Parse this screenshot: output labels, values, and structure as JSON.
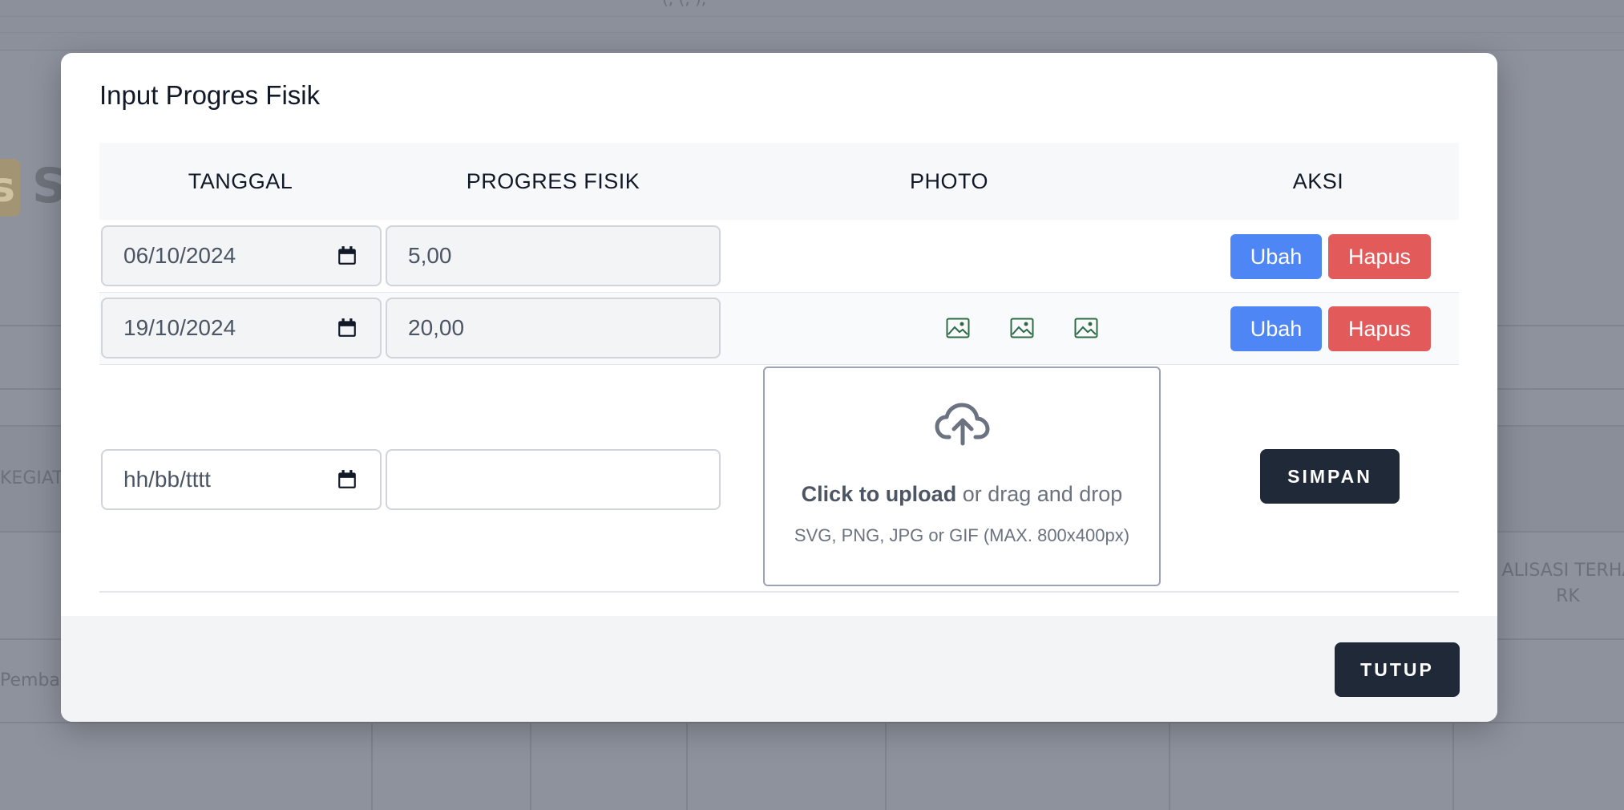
{
  "background": {
    "top_text": "(, (, ),",
    "logo_letter": "s",
    "title_initial": "S",
    "col_partial_left": "KEGIATA",
    "col_partial_right_line1": "ALISASI TERHA",
    "col_partial_right_line2": "RK",
    "row_partial_left": "Pemba"
  },
  "modal": {
    "title": "Input Progres Fisik",
    "table": {
      "headers": [
        "TANGGAL",
        "PROGRES FISIK",
        "PHOTO",
        "AKSI"
      ],
      "rows": [
        {
          "date": "06/10/2024",
          "progress": "5,00",
          "photos": []
        },
        {
          "date": "19/10/2024",
          "progress": "20,00",
          "photos": [
            "image-icon",
            "image-icon",
            "image-icon"
          ]
        }
      ],
      "new_row": {
        "date_placeholder": "hh/bb/tttt",
        "progress_value": ""
      }
    },
    "actions": {
      "edit_label": "Ubah",
      "delete_label": "Hapus",
      "save_label": "SIMPAN"
    },
    "upload": {
      "icon": "cloud-upload-icon",
      "click_text": "Click to upload",
      "drag_text": " or drag and drop",
      "hint": "SVG, PNG, JPG or GIF (MAX. 800x400px)"
    },
    "footer": {
      "close_label": "TUTUP"
    }
  },
  "colors": {
    "primary": "#4f86f5",
    "danger": "#e35a5a",
    "dark": "#1f2937",
    "icon_green": "#2f6b45"
  }
}
